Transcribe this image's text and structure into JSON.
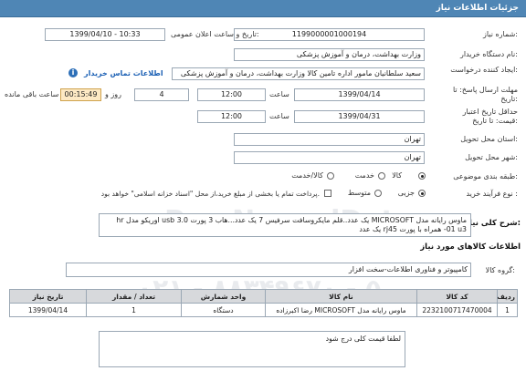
{
  "page": {
    "title": "جزئیات اطلاعات نیاز"
  },
  "labels": {
    "need_number": "شماره نیاز:",
    "announce_datetime": "تاریخ و ساعت اعلان عمومی:",
    "buyer_org": "نام دستگاه خریدار:",
    "requester": "ایجاد کننده درخواست:",
    "response_deadline": "مهلت ارسال پاسخ: تا تاریخ:",
    "min_price_validity": "حداقل تاریخ اعتبار قیمت: تا تاریخ:",
    "time": "ساعت",
    "day_and": "روز و",
    "remaining": "ساعت باقی مانده",
    "province": "استان محل تحویل:",
    "city": "شهر محل تحویل:",
    "subject_class": "طبقه بندی موضوعی:",
    "purchase_process": "نوع فرآیند خرید :",
    "need_summary": "شرح کلی نیاز:",
    "goods_info": "اطلاعات کالاهای مورد نیاز",
    "goods_group": "گروه کالا:"
  },
  "fields": {
    "need_number": "1199000001000194",
    "announce_datetime": "1399/04/10 - 10:33",
    "buyer_org": "وزارت بهداشت، درمان و آموزش پزشکی",
    "requester": "سعید سلطانیان مامور اداره تامین کالا وزارت بهداشت، درمان و آموزش پزشکی",
    "buyer_contact_link": "اطلاعات تماس خریدار",
    "deadline_date": "1399/04/14",
    "deadline_time": "12:00",
    "days_left": "4",
    "time_left": "00:15:49",
    "validity_date": "1399/04/31",
    "validity_time": "12:00",
    "province": "تهران",
    "city": "تهران",
    "goods_group": "کامپیوتر و فناوری اطلاعات-سخت افزار"
  },
  "subject_options": [
    {
      "label": "کالا",
      "selected": true
    },
    {
      "label": "خدمت",
      "selected": false
    },
    {
      "label": "کالا/خدمت",
      "selected": false
    }
  ],
  "process_options": [
    {
      "label": "جزیی",
      "selected": true
    },
    {
      "label": "متوسط",
      "selected": false
    }
  ],
  "payment_note": "پرداخت تمام یا بخشی از مبلغ خرید،از محل \"اسناد خزانه اسلامی\" خواهد بود.",
  "need_summary_text": "ماوس رایانه مدل MICROSOFT یک عدد..قلم مایکروسافت سرفیس 7 یک عدد...هاب 3 پورت usb 3.0 اوریکو مدل hr -01 u3 همراه با پورت rj45 یک عدد",
  "table": {
    "headers": [
      "ردیف",
      "کد کالا",
      "نام کالا",
      "واحد شمارش",
      "تعداد / مقدار",
      "تاریخ نیاز"
    ],
    "rows": [
      [
        "1",
        "2232100717470004",
        "ماوس رایانه مدل MICROSOFT رضا اکبرزاده",
        "دستگاه",
        "1",
        "1399/04/14"
      ]
    ]
  },
  "buyer_notes": "لطفا قیمت کلی درج شود",
  "watermark": {
    "brand": "ParsNamadData",
    "phone": "۰۲۱ - ۸۸۳۴۹۶۷۰ - ۵"
  }
}
